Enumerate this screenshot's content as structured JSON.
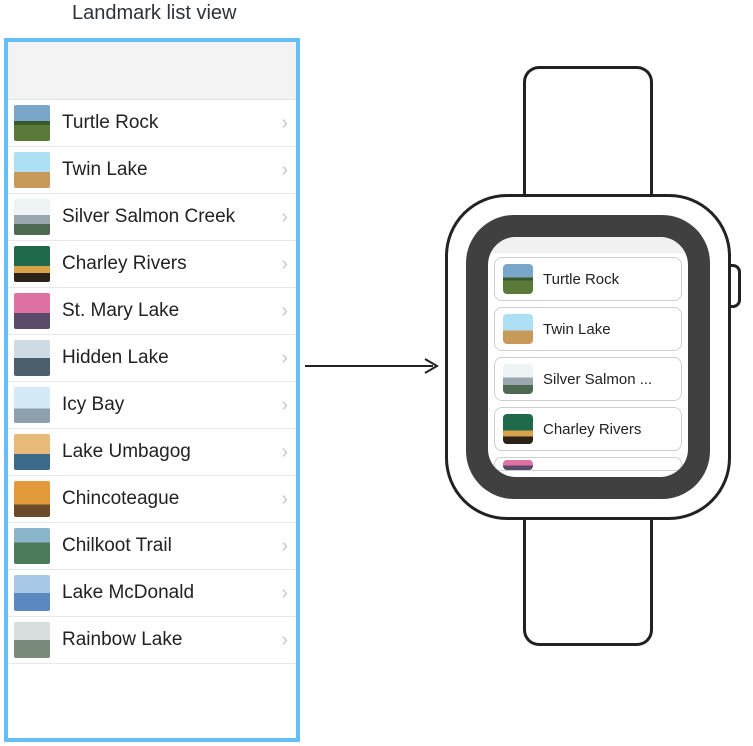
{
  "title": "Landmark list view",
  "phone": {
    "rows": [
      {
        "label": "Turtle Rock",
        "thumb_css": "linear-gradient(#7aa7c9 0 45%, #3a5a2c 45% 55%, #5b7a3a 55% 100%)"
      },
      {
        "label": "Twin Lake",
        "thumb_css": "linear-gradient(#aee0f5 0 55%, #c79a5a 55% 100%)"
      },
      {
        "label": "Silver Salmon Creek",
        "thumb_css": "linear-gradient(#eef3f6 0 45%, #9aa7af 45% 70%, #4e6a53 70% 100%)"
      },
      {
        "label": "Charley Rivers",
        "thumb_css": "linear-gradient(#1f6a4a 0 55%, #d9a14a 55% 75%, #2a2118 75% 100%)"
      },
      {
        "label": "St. Mary Lake",
        "thumb_css": "linear-gradient(#e071a3 0 55%, #5a4a6a 55% 100%)"
      },
      {
        "label": "Hidden Lake",
        "thumb_css": "linear-gradient(#cedbe4 0 50%, #4b5f6c 50% 100%)"
      },
      {
        "label": "Icy Bay",
        "thumb_css": "linear-gradient(#d4eaf6 0 60%, #8da0ac 60% 100%)"
      },
      {
        "label": "Lake Umbagog",
        "thumb_css": "linear-gradient(#e8ba7a 0 55%, #3b6a8a 55% 100%)"
      },
      {
        "label": "Chincoteague",
        "thumb_css": "linear-gradient(#e29a3a 0 65%, #6a4a2a 65% 100%)"
      },
      {
        "label": "Chilkoot Trail",
        "thumb_css": "linear-gradient(#8ab4c9 0 40%, #4a7a5a 40% 100%)"
      },
      {
        "label": "Lake McDonald",
        "thumb_css": "linear-gradient(#a7c8e6 0 50%, #5a8abf 50% 100%)"
      },
      {
        "label": "Rainbow Lake",
        "thumb_css": "linear-gradient(#d9dde0 0 50%, #7a8a7a 50% 100%)"
      }
    ]
  },
  "watch": {
    "rows": [
      {
        "label": "Turtle Rock",
        "thumb_css": "linear-gradient(#7aa7c9 0 45%, #3a5a2c 45% 55%, #5b7a3a 55% 100%)"
      },
      {
        "label": "Twin Lake",
        "thumb_css": "linear-gradient(#aee0f5 0 55%, #c79a5a 55% 100%)"
      },
      {
        "label": "Silver Salmon ...",
        "thumb_css": "linear-gradient(#eef3f6 0 45%, #9aa7af 45% 70%, #4e6a53 70% 100%)"
      },
      {
        "label": "Charley Rivers",
        "thumb_css": "linear-gradient(#1f6a4a 0 55%, #d9a14a 55% 75%, #2a2118 75% 100%)"
      }
    ],
    "partial_row_thumb_css": "linear-gradient(#e071a3 0 55%, #5a4a6a 55% 100%)"
  }
}
